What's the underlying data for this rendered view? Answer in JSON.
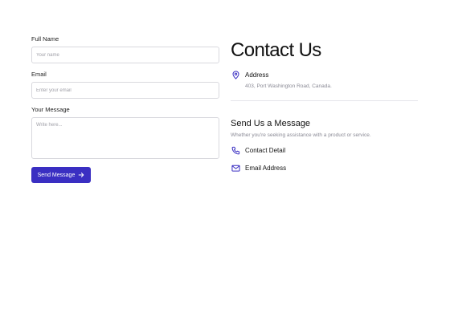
{
  "form": {
    "name_label": "Full Name",
    "name_placeholder": "Your name",
    "email_label": "Email",
    "email_placeholder": "Enter your email",
    "message_label": "Your Message",
    "message_placeholder": "Write here...",
    "submit_label": "Send Message"
  },
  "contact": {
    "title": "Contact Us",
    "address_title": "Address",
    "address_text": "403, Port Washington Road, Canada.",
    "send_title": "Send Us a Message",
    "send_subtitle": "Whether you're seeking assistance with a product or service.",
    "contact_detail": "Contact Detail",
    "email_address": "Email Address"
  },
  "colors": {
    "accent": "#3a2fc2",
    "muted_text": "#8a8a95",
    "border": "#d9d9de"
  },
  "icons": [
    "location-pin-icon",
    "phone-icon",
    "mail-icon",
    "arrow-right-icon"
  ]
}
